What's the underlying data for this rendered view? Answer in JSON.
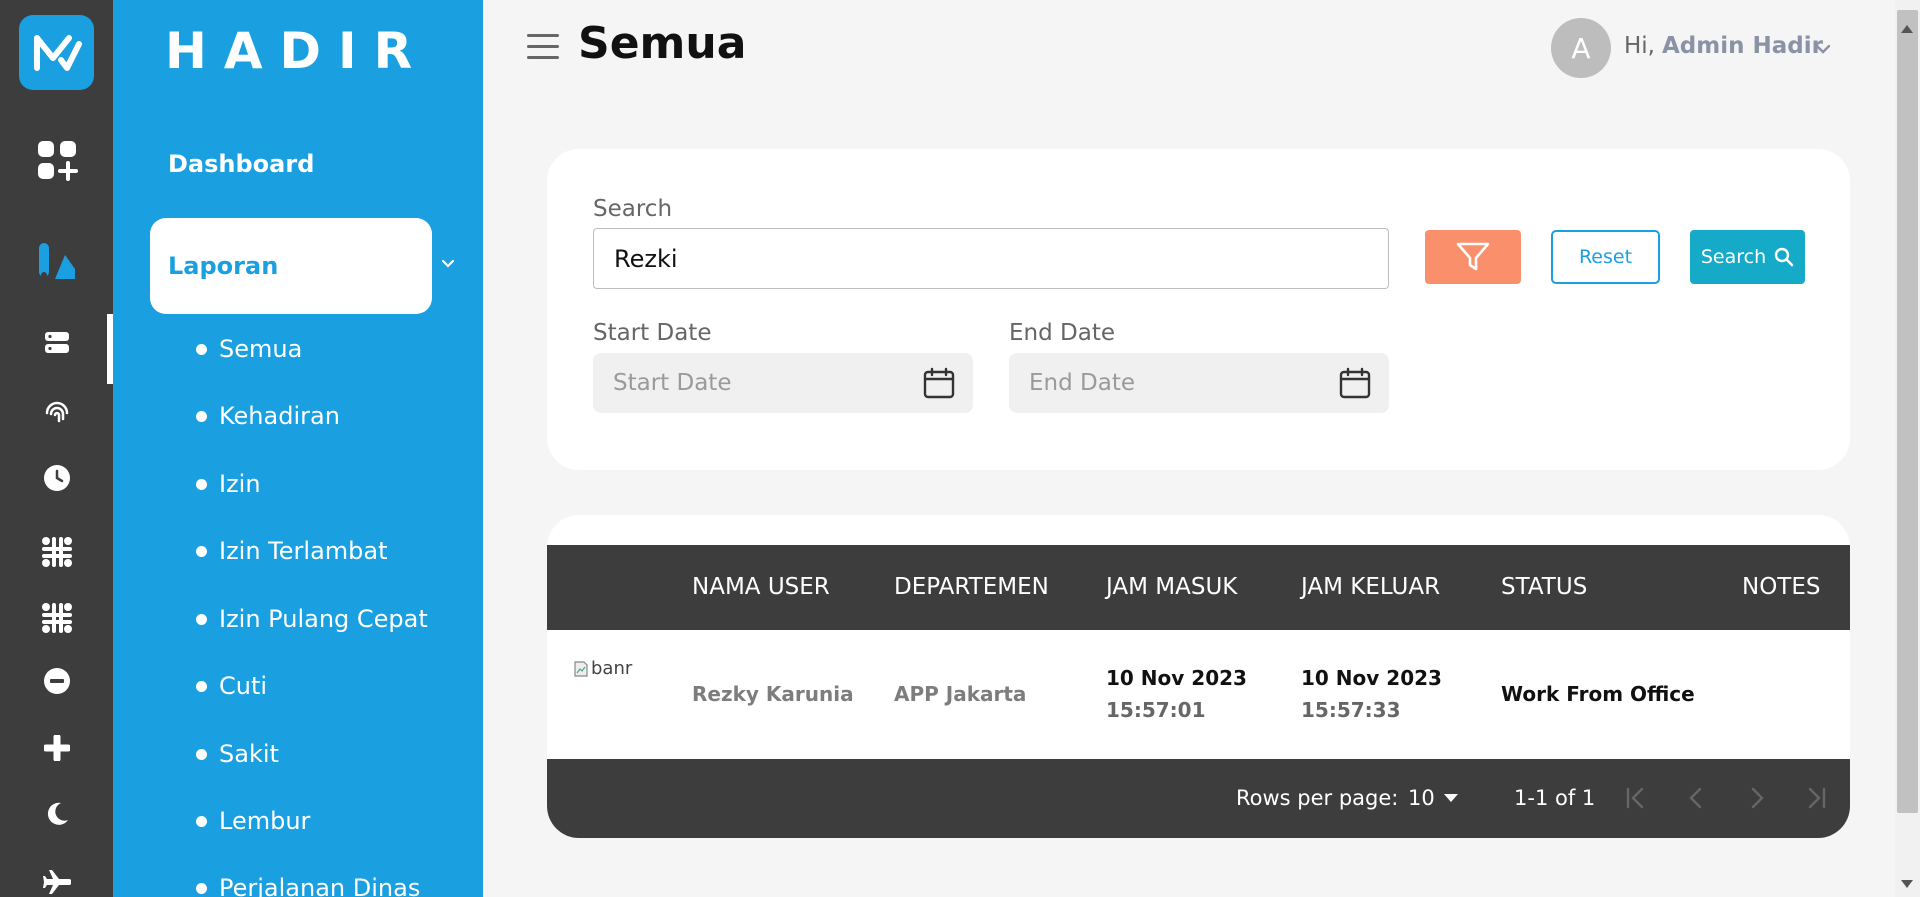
{
  "app": {
    "brand": "HADIR"
  },
  "rail": {
    "icons": [
      "logo-icon",
      "apps-add-icon",
      "report-icon",
      "server-icon",
      "fingerprint-icon",
      "clock-icon",
      "grid-icon",
      "grid-icon",
      "minus-circle-icon",
      "plus-icon",
      "moon-icon",
      "plane-icon"
    ]
  },
  "menu": {
    "dashboard": "Dashboard",
    "laporan": "Laporan",
    "sub_items": [
      "Semua",
      "Kehadiran",
      "Izin",
      "Izin Terlambat",
      "Izin Pulang Cepat",
      "Cuti",
      "Sakit",
      "Lembur",
      "Perjalanan Dinas"
    ]
  },
  "header": {
    "title": "Semua",
    "avatar_initial": "A",
    "greeting": "Hi,",
    "user_name": "Admin Hadir"
  },
  "filters": {
    "search_label": "Search",
    "search_value": "Rezki",
    "start_date_label": "Start Date",
    "start_date_placeholder": "Start Date",
    "end_date_label": "End Date",
    "end_date_placeholder": "End Date",
    "reset_label": "Reset",
    "search_button_label": "Search"
  },
  "table": {
    "columns": [
      "NAMA USER",
      "DEPARTEMEN",
      "JAM MASUK",
      "JAM KELUAR",
      "STATUS",
      "NOTES"
    ],
    "rows": [
      {
        "image_alt": "banr",
        "nama_user": "Rezky Karunia",
        "departemen": "APP Jakarta",
        "jam_masuk_date": "10 Nov 2023",
        "jam_masuk_time": "15:57:01",
        "jam_keluar_date": "10 Nov 2023",
        "jam_keluar_time": "15:57:33",
        "status": "Work From Office",
        "notes": ""
      }
    ],
    "footer": {
      "rows_per_page_label": "Rows per page:",
      "rows_per_page_value": "10",
      "range": "1-1 of 1"
    }
  },
  "colors": {
    "primary": "#1a9fe0",
    "rail": "#3d3d3d",
    "filter_button": "#fa8f6b",
    "search_button": "#15aac8"
  }
}
